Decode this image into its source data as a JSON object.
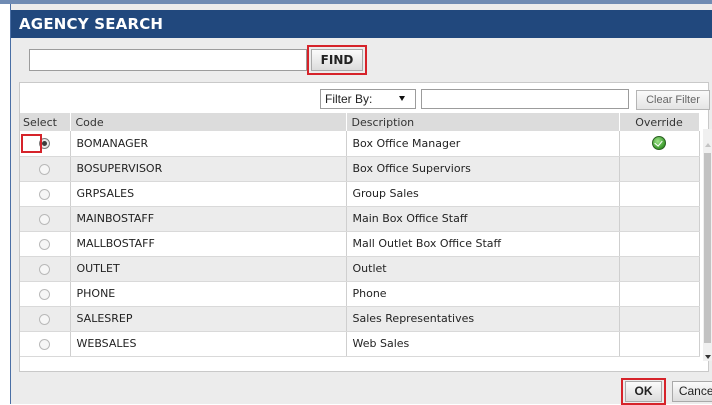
{
  "dialog": {
    "title": "AGENCY SEARCH",
    "search": {
      "value": "",
      "placeholder": ""
    },
    "find_label": "FIND"
  },
  "filter": {
    "label": "Filter By:",
    "value": "",
    "clear_label": "Clear Filter"
  },
  "table": {
    "headers": {
      "select": "Select",
      "code": "Code",
      "description": "Description",
      "override": "Override"
    },
    "rows": [
      {
        "code": "BOMANAGER",
        "description": "Box Office Manager",
        "selected": true,
        "override": true
      },
      {
        "code": "BOSUPERVISOR",
        "description": "Box Office Superviors",
        "selected": false,
        "override": false
      },
      {
        "code": "GRPSALES",
        "description": "Group Sales",
        "selected": false,
        "override": false
      },
      {
        "code": "MAINBOSTAFF",
        "description": "Main Box Office Staff",
        "selected": false,
        "override": false
      },
      {
        "code": "MALLBOSTAFF",
        "description": "Mall Outlet Box Office Staff",
        "selected": false,
        "override": false
      },
      {
        "code": "OUTLET",
        "description": "Outlet",
        "selected": false,
        "override": false
      },
      {
        "code": "PHONE",
        "description": "Phone",
        "selected": false,
        "override": false
      },
      {
        "code": "SALESREP",
        "description": "Sales Representatives",
        "selected": false,
        "override": false
      },
      {
        "code": "WEBSALES",
        "description": "Web Sales",
        "selected": false,
        "override": false
      }
    ]
  },
  "footer": {
    "ok_label": "OK",
    "cancel_label": "Cancel"
  },
  "colors": {
    "title_bar": "#21487d",
    "highlight": "#d6232a",
    "check": "#3a9a2b"
  },
  "icons": {
    "override_true": "green-check-circle-icon",
    "radio": "radio-button-icon"
  }
}
